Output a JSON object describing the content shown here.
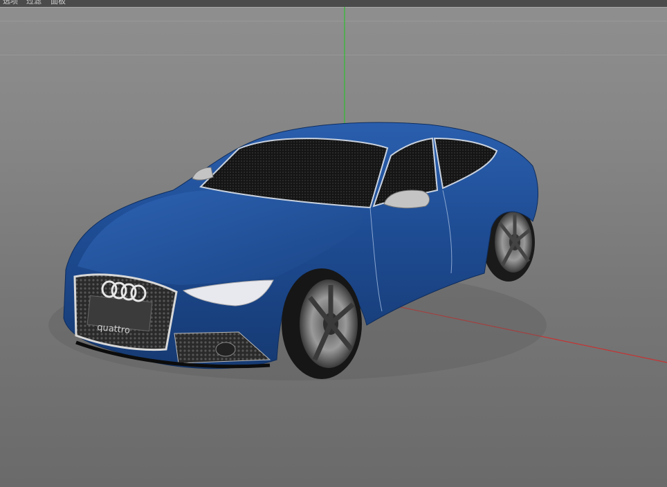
{
  "menubar": {
    "items": [
      {
        "label": "选项"
      },
      {
        "label": "过滤"
      },
      {
        "label": "面板"
      }
    ]
  },
  "viewport": {
    "background": "#7d7d7d",
    "axis_colors": {
      "y": "#2fbf2f",
      "x": "#c83232"
    }
  },
  "model": {
    "body_color": "#1f4f96",
    "badge_text": "quattro"
  }
}
